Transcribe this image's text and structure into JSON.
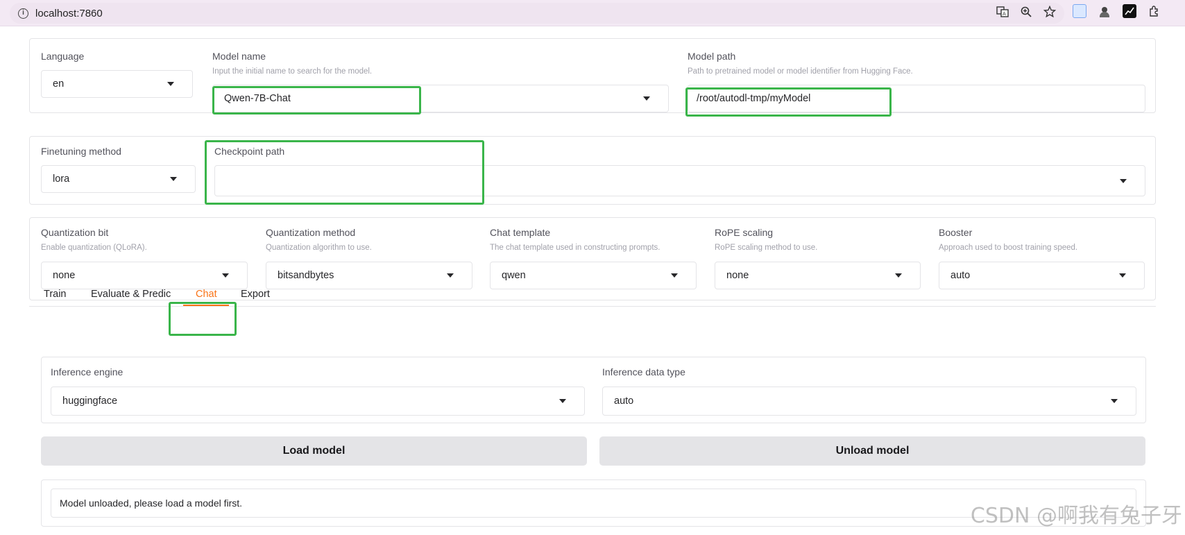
{
  "browser": {
    "url": "localhost:7860",
    "info_glyph": "i"
  },
  "top_panel": {
    "language": {
      "label": "Language",
      "value": "en"
    },
    "model_name": {
      "label": "Model name",
      "info": "Input the initial name to search for the model.",
      "value": "Qwen-7B-Chat"
    },
    "model_path": {
      "label": "Model path",
      "info": "Path to pretrained model or model identifier from Hugging Face.",
      "value": "/root/autodl-tmp/myModel"
    }
  },
  "finetune_panel": {
    "method": {
      "label": "Finetuning method",
      "value": "lora"
    },
    "checkpoint": {
      "label": "Checkpoint path",
      "value": ""
    }
  },
  "advanced_panel": {
    "quant_bit": {
      "label": "Quantization bit",
      "info": "Enable quantization (QLoRA).",
      "value": "none"
    },
    "quant_method": {
      "label": "Quantization method",
      "info": "Quantization algorithm to use.",
      "value": "bitsandbytes"
    },
    "chat_template": {
      "label": "Chat template",
      "info": "The chat template used in constructing prompts.",
      "value": "qwen"
    },
    "rope": {
      "label": "RoPE scaling",
      "info": "RoPE scaling method to use.",
      "value": "none"
    },
    "booster": {
      "label": "Booster",
      "info": "Approach used to boost training speed.",
      "value": "auto"
    }
  },
  "tabs": [
    {
      "label": "Train"
    },
    {
      "label": "Evaluate & Predic"
    },
    {
      "label": "Chat"
    },
    {
      "label": "Export"
    }
  ],
  "active_tab": "Chat",
  "chat": {
    "engine": {
      "label": "Inference engine",
      "value": "huggingface"
    },
    "dtype": {
      "label": "Inference data type",
      "value": "auto"
    },
    "load_button": "Load model",
    "unload_button": "Unload model",
    "status": "Model unloaded, please load a model first."
  },
  "watermark": "CSDN @啊我有兔子牙",
  "colors": {
    "accent": "#f97316",
    "highlight": "#3ab54a",
    "button_bg": "#e4e4e7"
  }
}
